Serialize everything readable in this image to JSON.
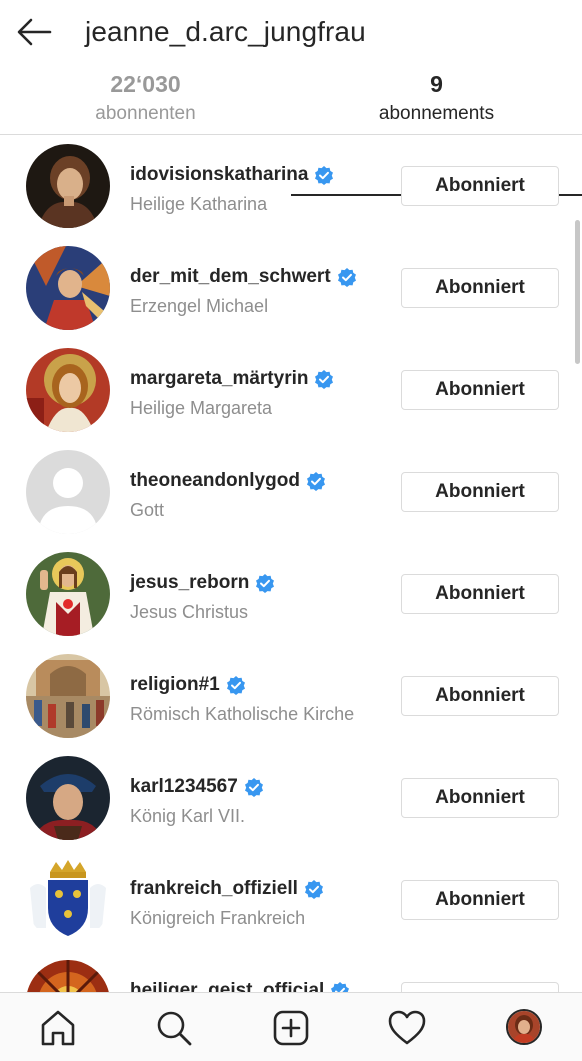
{
  "header": {
    "back_icon": "arrow-left-icon",
    "title": "jeanne_d.arc_jungfrau"
  },
  "tabs": [
    {
      "count": "22‘030",
      "label": "abonnenten",
      "active": false
    },
    {
      "count": "9",
      "label": "abonnements",
      "active": true
    }
  ],
  "verified_color": "#3897f0",
  "following": [
    {
      "username": "idovisionskatharina",
      "name": "Heilige Katharina",
      "verified": true,
      "button": "Abonniert",
      "avatar": "saint-catherine-painting"
    },
    {
      "username": "der_mit_dem_schwert",
      "name": "Erzengel Michael",
      "verified": true,
      "button": "Abonniert",
      "avatar": "archangel-michael-painting"
    },
    {
      "username": "margareta_märtyrin",
      "name": "Heilige Margareta",
      "verified": true,
      "button": "Abonniert",
      "avatar": "saint-margaret-painting"
    },
    {
      "username": "theoneandonlygod",
      "name": "Gott",
      "verified": true,
      "button": "Abonniert",
      "avatar": "default-person-placeholder"
    },
    {
      "username": "jesus_reborn",
      "name": "Jesus Christus",
      "verified": true,
      "button": "Abonniert",
      "avatar": "buddy-christ-figure"
    },
    {
      "username": "religion#1",
      "name": "Römisch Katholische Kirche",
      "verified": true,
      "button": "Abonniert",
      "avatar": "church-fresco"
    },
    {
      "username": "karl1234567",
      "name": "König Karl VII.",
      "verified": true,
      "button": "Abonniert",
      "avatar": "king-charles-portrait"
    },
    {
      "username": "frankreich_offiziell",
      "name": "Königreich Frankreich",
      "verified": true,
      "button": "Abonniert",
      "avatar": "french-royal-coat-of-arms"
    },
    {
      "username": "heiliger_geist_official",
      "name": "",
      "verified": true,
      "button": "",
      "avatar": "stained-glass-dove"
    }
  ],
  "bottom_nav": [
    {
      "name": "home",
      "icon": "home-icon"
    },
    {
      "name": "search",
      "icon": "search-icon"
    },
    {
      "name": "new-post",
      "icon": "add-post-icon"
    },
    {
      "name": "activity",
      "icon": "heart-icon"
    },
    {
      "name": "profile",
      "icon": "profile-avatar"
    }
  ]
}
